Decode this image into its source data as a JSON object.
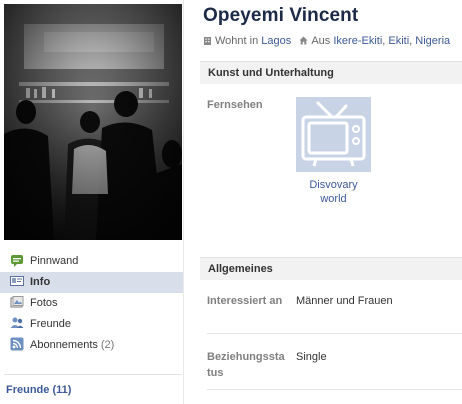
{
  "profile": {
    "name": "Opeyemi Vincent",
    "lives_prefix": "Wohnt in",
    "lives_city": "Lagos",
    "from_prefix": "Aus",
    "from_city": "Ikere-Ekiti",
    "from_sep1": ", ",
    "from_region": "Ekiti",
    "from_sep2": ", ",
    "from_country": "Nigeria"
  },
  "nav": {
    "items": [
      {
        "label": "Pinnwand",
        "icon": "wall-icon"
      },
      {
        "label": "Info",
        "icon": "info-card-icon",
        "active": true
      },
      {
        "label": "Fotos",
        "icon": "photos-icon"
      },
      {
        "label": "Freunde",
        "icon": "friends-icon"
      },
      {
        "label": "Abonnements",
        "icon": "rss-icon",
        "count": "(2)"
      }
    ],
    "friends_heading": "Freunde (11)"
  },
  "sections": {
    "kunst": {
      "title": "Kunst und Unterhaltung",
      "tv_label": "Fernsehen",
      "tv_item": "Disvovary world"
    },
    "allgemeines": {
      "title": "Allgemeines",
      "interested_label": "Interessiert an",
      "interested_value": "Männer und Frauen",
      "relationship_label": "Beziehungsstatus",
      "relationship_value": "Single"
    }
  },
  "colors": {
    "link": "#3b5998",
    "name": "#1c2a47",
    "active_nav": "#d8dfea",
    "section_bg": "#f2f2f2",
    "tv_tile": "#c9d3e6"
  }
}
